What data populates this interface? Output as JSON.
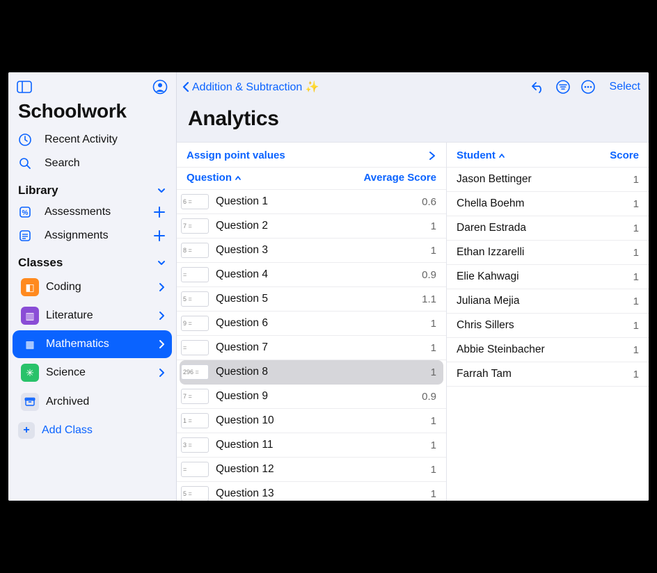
{
  "app": {
    "title": "Schoolwork"
  },
  "sidebar": {
    "recent_label": "Recent Activity",
    "search_label": "Search",
    "library_label": "Library",
    "library_items": [
      {
        "label": "Assessments"
      },
      {
        "label": "Assignments"
      }
    ],
    "classes_label": "Classes",
    "classes": [
      {
        "label": "Coding",
        "color": "#ff8a1f",
        "glyph": "◧",
        "selected": false
      },
      {
        "label": "Literature",
        "color": "#8a4dd6",
        "glyph": "▥",
        "selected": false
      },
      {
        "label": "Mathematics",
        "color": "#0a63ff",
        "glyph": "▦",
        "selected": true
      },
      {
        "label": "Science",
        "color": "#29c26a",
        "glyph": "✳",
        "selected": false
      }
    ],
    "archived_label": "Archived",
    "add_class_label": "Add Class"
  },
  "toolbar": {
    "back_label": "Addition & Subtraction ✨",
    "select_label": "Select"
  },
  "page": {
    "title": "Analytics",
    "assign_points_label": "Assign point values",
    "question_header": "Question",
    "avg_score_header": "Average Score",
    "student_header": "Student",
    "score_header": "Score"
  },
  "questions": [
    {
      "thumb": "6 = ",
      "label": "Question 1",
      "score": "0.6",
      "selected": false
    },
    {
      "thumb": "7 = ",
      "label": "Question 2",
      "score": "1",
      "selected": false
    },
    {
      "thumb": "8 = ",
      "label": "Question 3",
      "score": "1",
      "selected": false
    },
    {
      "thumb": "  = ",
      "label": "Question 4",
      "score": "0.9",
      "selected": false
    },
    {
      "thumb": "5 = ",
      "label": "Question 5",
      "score": "1.1",
      "selected": false
    },
    {
      "thumb": "9 = ",
      "label": "Question 6",
      "score": "1",
      "selected": false
    },
    {
      "thumb": "  = ",
      "label": "Question 7",
      "score": "1",
      "selected": false
    },
    {
      "thumb": "296 = ",
      "label": "Question 8",
      "score": "1",
      "selected": true
    },
    {
      "thumb": "7 = ",
      "label": "Question 9",
      "score": "0.9",
      "selected": false
    },
    {
      "thumb": "1 = ",
      "label": "Question 10",
      "score": "1",
      "selected": false
    },
    {
      "thumb": "3 = ",
      "label": "Question 11",
      "score": "1",
      "selected": false
    },
    {
      "thumb": "  = ",
      "label": "Question 12",
      "score": "1",
      "selected": false
    },
    {
      "thumb": "5 = ",
      "label": "Question 13",
      "score": "1",
      "selected": false
    }
  ],
  "students": [
    {
      "name": "Jason Bettinger",
      "score": "1"
    },
    {
      "name": "Chella Boehm",
      "score": "1"
    },
    {
      "name": "Daren Estrada",
      "score": "1"
    },
    {
      "name": "Ethan Izzarelli",
      "score": "1"
    },
    {
      "name": "Elie Kahwagi",
      "score": "1"
    },
    {
      "name": "Juliana Mejia",
      "score": "1"
    },
    {
      "name": "Chris Sillers",
      "score": "1"
    },
    {
      "name": "Abbie Steinbacher",
      "score": "1"
    },
    {
      "name": "Farrah Tam",
      "score": "1"
    }
  ]
}
